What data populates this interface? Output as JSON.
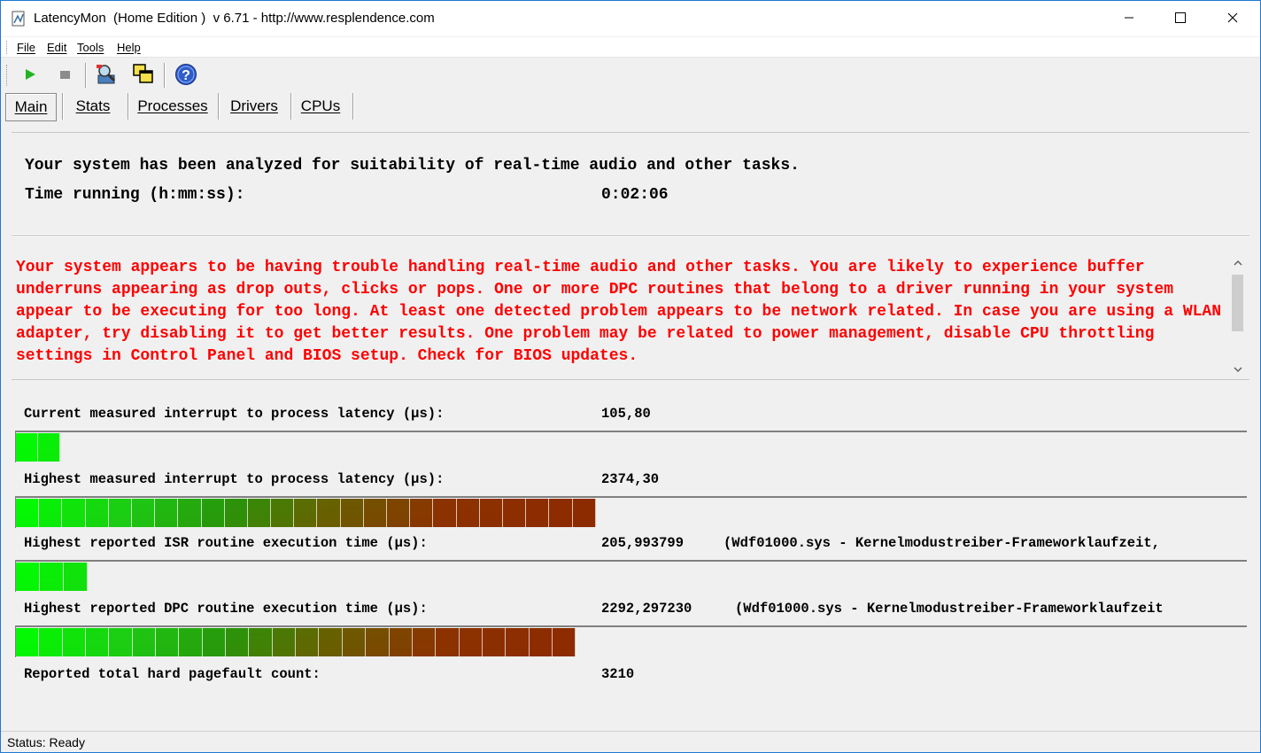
{
  "window": {
    "title": "LatencyMon  (Home Edition )  v 6.71 - http://www.resplendence.com",
    "minimize_icon": "minimize-icon",
    "maximize_icon": "maximize-icon",
    "close_icon": "close-icon"
  },
  "menu": [
    "File",
    "Edit",
    "Tools",
    "Help"
  ],
  "toolbar": {
    "buttons": [
      "play-icon",
      "stop-icon",
      "inspect-icon",
      "windows-icon",
      "help-icon"
    ],
    "help_glyph": "?"
  },
  "tabs": [
    "Main",
    "Stats",
    "Processes",
    "Drivers",
    "CPUs"
  ],
  "active_tab": "Main",
  "main": {
    "conclusion": "Your system has been analyzed for suitability of real-time audio and other tasks.",
    "time_label": "Time running (h:mm:ss):",
    "time_value": "0:02:06",
    "warning": "Your system appears to be having trouble handling real-time audio and other tasks. You are likely to experience buffer underruns appearing as drop outs, clicks or pops. One or more DPC routines that belong to a driver running in your system appear to be executing for too long. At least one detected problem appears to be network related. In case you are using a WLAN adapter, try disabling it to get better results. One problem may be related to power management, disable CPU throttling settings in Control Panel and BIOS setup. Check for BIOS updates.",
    "warning_color": "#ff0000"
  },
  "metrics": [
    {
      "label": "Current measured interrupt to process latency (µs):",
      "value": "105,80",
      "extra": "",
      "bar_fraction": 0.036
    },
    {
      "label": "Highest measured interrupt to process latency (µs):",
      "value": "2374,30",
      "extra": "",
      "bar_fraction": 0.471
    },
    {
      "label": "Highest reported ISR routine execution time (µs):",
      "value": "205,993799",
      "extra": "(Wdf01000.sys - Kernelmodustreiber-Frameworklaufzeit,",
      "bar_fraction": 0.058
    },
    {
      "label": "Highest reported DPC routine execution time (µs):",
      "value": "2292,297230",
      "extra": "(Wdf01000.sys - Kernelmodustreiber-Frameworklaufzeit",
      "bar_fraction": 0.455
    },
    {
      "label": "Reported total hard pagefault count:",
      "value": "3210",
      "extra": "",
      "bar_fraction": null
    }
  ],
  "status": {
    "text": "Status: Ready"
  }
}
